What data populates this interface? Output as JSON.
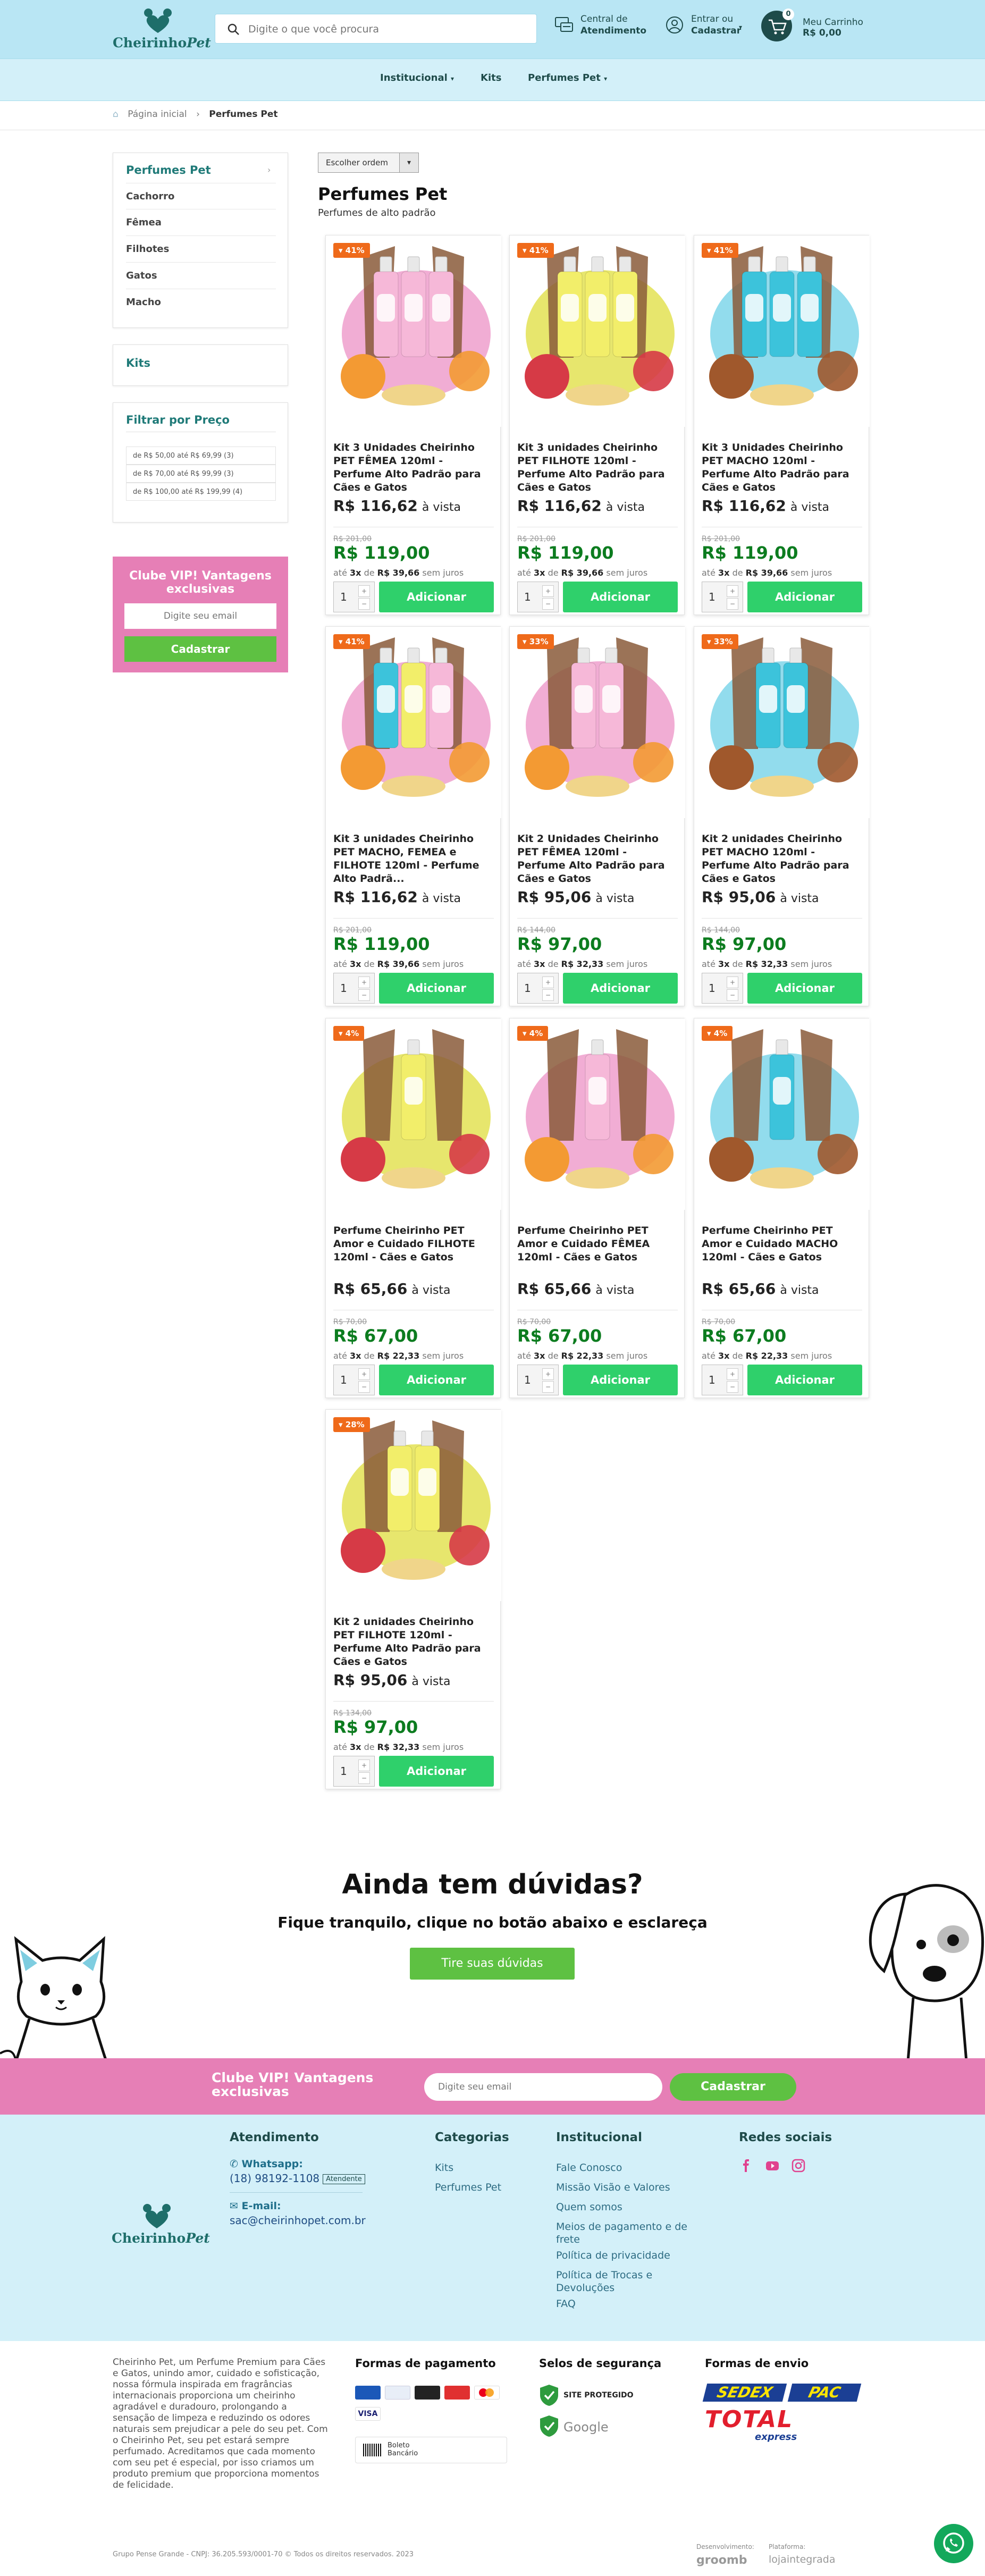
{
  "brand": {
    "name_main": "Cheirinho",
    "name_accent": "Pet",
    "colors": {
      "header": "#b9e6f4",
      "nav": "#d3f0f9",
      "accent": "#1f7a78",
      "pink": "#e67fb6",
      "green": "#5ec142",
      "add_button": "#2fd06b",
      "discount": "#ef6a1a",
      "price_green": "#0c7c1f"
    }
  },
  "header": {
    "search_placeholder": "Digite o que você procura",
    "service": {
      "line1": "Central de",
      "line2": "Atendimento"
    },
    "account": {
      "line1": "Entrar ou",
      "line2": "Cadastrar"
    },
    "cart": {
      "label": "Meu Carrinho",
      "total": "R$ 0,00",
      "count": "0"
    }
  },
  "nav": {
    "items": [
      "Institucional",
      "Kits",
      "Perfumes Pet"
    ]
  },
  "breadcrumb": {
    "home": "Página inicial",
    "current": "Perfumes Pet"
  },
  "sidebar": {
    "category_title": "Perfumes Pet",
    "categories": [
      "Cachorro",
      "Fêmea",
      "Filhotes",
      "Gatos",
      "Macho"
    ],
    "kits_title": "Kits",
    "price_title": "Filtrar por Preço",
    "price_ranges": [
      "de R$ 50,00 até R$ 69,99 (3)",
      "de R$ 70,00 até R$ 99,99 (3)",
      "de R$ 100,00 até R$ 199,99 (4)"
    ],
    "vip": {
      "title": "Clube VIP! Vantagens exclusivas",
      "placeholder": "Digite seu email",
      "button": "Cadastrar"
    }
  },
  "listing": {
    "sort_label": "Escolher ordem",
    "title": "Perfumes Pet",
    "subtitle": "Perfumes de alto padrão",
    "add_label": "Adicionar",
    "qty": "1",
    "cash_suffix": "à vista",
    "installment_prefix": "até",
    "installment_mid": "de",
    "installment_suffix": "sem juros",
    "products": [
      {
        "discount": "41%",
        "name": "Kit 3 Unidades Cheirinho PET FÊMEA 120ml - Perfume Alto Padrão para Cães e Gatos",
        "cash": "R$ 116,62",
        "old": "R$ 201,00",
        "price": "R$ 119,00",
        "inst_n": "3x",
        "inst_v": "R$ 39,66",
        "colors": [
          "#ef9fcd",
          "#f6b8d8",
          "#f6b8d8",
          "#f6b8d8"
        ],
        "fruit": "#f39a33"
      },
      {
        "discount": "41%",
        "name": "Kit 3 unidades Cheirinho PET FILHOTE 120ml - Perfume Alto Padrão para Cães e Gatos",
        "cash": "R$ 116,62",
        "old": "R$ 201,00",
        "price": "R$ 119,00",
        "inst_n": "3x",
        "inst_v": "R$ 39,66",
        "colors": [
          "#e3e254",
          "#f2ee6a",
          "#f2ee6a",
          "#f2ee6a"
        ],
        "fruit": "#d63a46"
      },
      {
        "discount": "41%",
        "name": "Kit 3 Unidades Cheirinho PET MACHO 120ml - Perfume Alto Padrão para Cães e Gatos",
        "cash": "R$ 116,62",
        "old": "R$ 201,00",
        "price": "R$ 119,00",
        "inst_n": "3x",
        "inst_v": "R$ 39,66",
        "colors": [
          "#7fd6ea",
          "#3cc3db",
          "#3cc3db",
          "#3cc3db"
        ],
        "fruit": "#a0582c"
      },
      {
        "discount": "41%",
        "name": "Kit 3 unidades Cheirinho PET MACHO, FEMEA e FILHOTE 120ml - Perfume Alto Padrã...",
        "cash": "R$ 116,62",
        "old": "R$ 201,00",
        "price": "R$ 119,00",
        "inst_n": "3x",
        "inst_v": "R$ 39,66",
        "colors": [
          "#ef9fcd",
          "#3cc3db",
          "#f2ee6a",
          "#f6b8d8"
        ],
        "fruit": "#f39a33"
      },
      {
        "discount": "33%",
        "name": "Kit 2 Unidades Cheirinho PET FÊMEA 120ml - Perfume Alto Padrão para Cães e Gatos",
        "cash": "R$ 95,06",
        "old": "R$ 144,00",
        "price": "R$ 97,00",
        "inst_n": "3x",
        "inst_v": "R$ 32,33",
        "colors": [
          "#ef9fcd",
          "#f6b8d8",
          "#f6b8d8"
        ],
        "fruit": "#f39a33"
      },
      {
        "discount": "33%",
        "name": "Kit 2 unidades Cheirinho PET MACHO 120ml - Perfume Alto Padrão para Cães e Gatos",
        "cash": "R$ 95,06",
        "old": "R$ 144,00",
        "price": "R$ 97,00",
        "inst_n": "3x",
        "inst_v": "R$ 32,33",
        "colors": [
          "#7fd6ea",
          "#3cc3db",
          "#3cc3db"
        ],
        "fruit": "#a0582c"
      },
      {
        "discount": "4%",
        "name": "Perfume Cheirinho PET Amor e Cuidado FILHOTE 120ml - Cães e Gatos",
        "cash": "R$ 65,66",
        "old": "R$ 70,00",
        "price": "R$ 67,00",
        "inst_n": "3x",
        "inst_v": "R$ 22,33",
        "colors": [
          "#e3e254",
          "#f2ee6a"
        ],
        "fruit": "#d63a46"
      },
      {
        "discount": "4%",
        "name": "Perfume Cheirinho PET Amor e Cuidado FÊMEA 120ml - Cães e Gatos",
        "cash": "R$ 65,66",
        "old": "R$ 70,00",
        "price": "R$ 67,00",
        "inst_n": "3x",
        "inst_v": "R$ 22,33",
        "colors": [
          "#ef9fcd",
          "#f6b8d8"
        ],
        "fruit": "#f39a33"
      },
      {
        "discount": "4%",
        "name": "Perfume Cheirinho PET Amor e Cuidado MACHO 120ml - Cães e Gatos",
        "cash": "R$ 65,66",
        "old": "R$ 70,00",
        "price": "R$ 67,00",
        "inst_n": "3x",
        "inst_v": "R$ 22,33",
        "colors": [
          "#7fd6ea",
          "#3cc3db"
        ],
        "fruit": "#a0582c"
      },
      {
        "discount": "28%",
        "name": "Kit 2 unidades Cheirinho PET FILHOTE 120ml - Perfume Alto Padrão para Cães e Gatos",
        "cash": "R$ 95,06",
        "old": "R$ 134,00",
        "price": "R$ 97,00",
        "inst_n": "3x",
        "inst_v": "R$ 32,33",
        "colors": [
          "#e3e254",
          "#f2ee6a",
          "#f2ee6a"
        ],
        "fruit": "#d63a46"
      }
    ]
  },
  "faq": {
    "title": "Ainda tem dúvidas?",
    "subtitle": "Fique tranquilo, clique no botão abaixo e esclareça",
    "button": "Tire suas dúvidas"
  },
  "newsletter": {
    "title": "Clube VIP! Vantagens exclusivas",
    "placeholder": "Digite seu email",
    "button": "Cadastrar"
  },
  "footer": {
    "attendance": {
      "title": "Atendimento",
      "whatsapp_label": "Whatsapp:",
      "whatsapp": "(18) 98192-1108",
      "whatsapp_tag": "Atendente",
      "email_label": "E-mail:",
      "email": "sac@cheirinhopet.com.br"
    },
    "categories": {
      "title": "Categorias",
      "items": [
        "Kits",
        "Perfumes Pet"
      ]
    },
    "institutional": {
      "title": "Institucional",
      "items": [
        "Fale Conosco",
        "Missão Visão e Valores",
        "Quem somos",
        "Meios de pagamento e de",
        "frete",
        "Política de privacidade",
        "Política de Trocas e",
        "Devoluções",
        "FAQ"
      ]
    },
    "social": {
      "title": "Redes sociais"
    },
    "about": "Cheirinho Pet, um Perfume Premium para Cães e Gatos, unindo amor, cuidado e sofisticação, nossa fórmula inspirada em fragrâncias internacionais proporciona um cheirinho agradável e duradouro, prolongando a sensação de limpeza e reduzindo os odores naturais sem prejudicar a pele do seu pet. Com o Cheirinho Pet, seu pet estará sempre perfumado. Acreditamos que cada momento com seu pet é especial, por isso criamos um produto premium que proporciona momentos de felicidade.",
    "payment_title": "Formas de pagamento",
    "boleto": "Boleto Bancário",
    "security_title": "Selos de segurança",
    "security_site": "SITE PROTEGIDO",
    "security_google": "Google",
    "shipping_title": "Formas de envio",
    "shipping": [
      "SEDEX",
      "PAC",
      "TOTAL",
      "express"
    ],
    "copyright": "Grupo Pense Grande - CNPJ: 36.205.593/0001-70 © Todos os direitos reservados. 2023",
    "dev_label": "Desenvolvimento:",
    "dev": "groomb",
    "platform_label": "Plataforma:",
    "platform": "lojaintegrada"
  }
}
